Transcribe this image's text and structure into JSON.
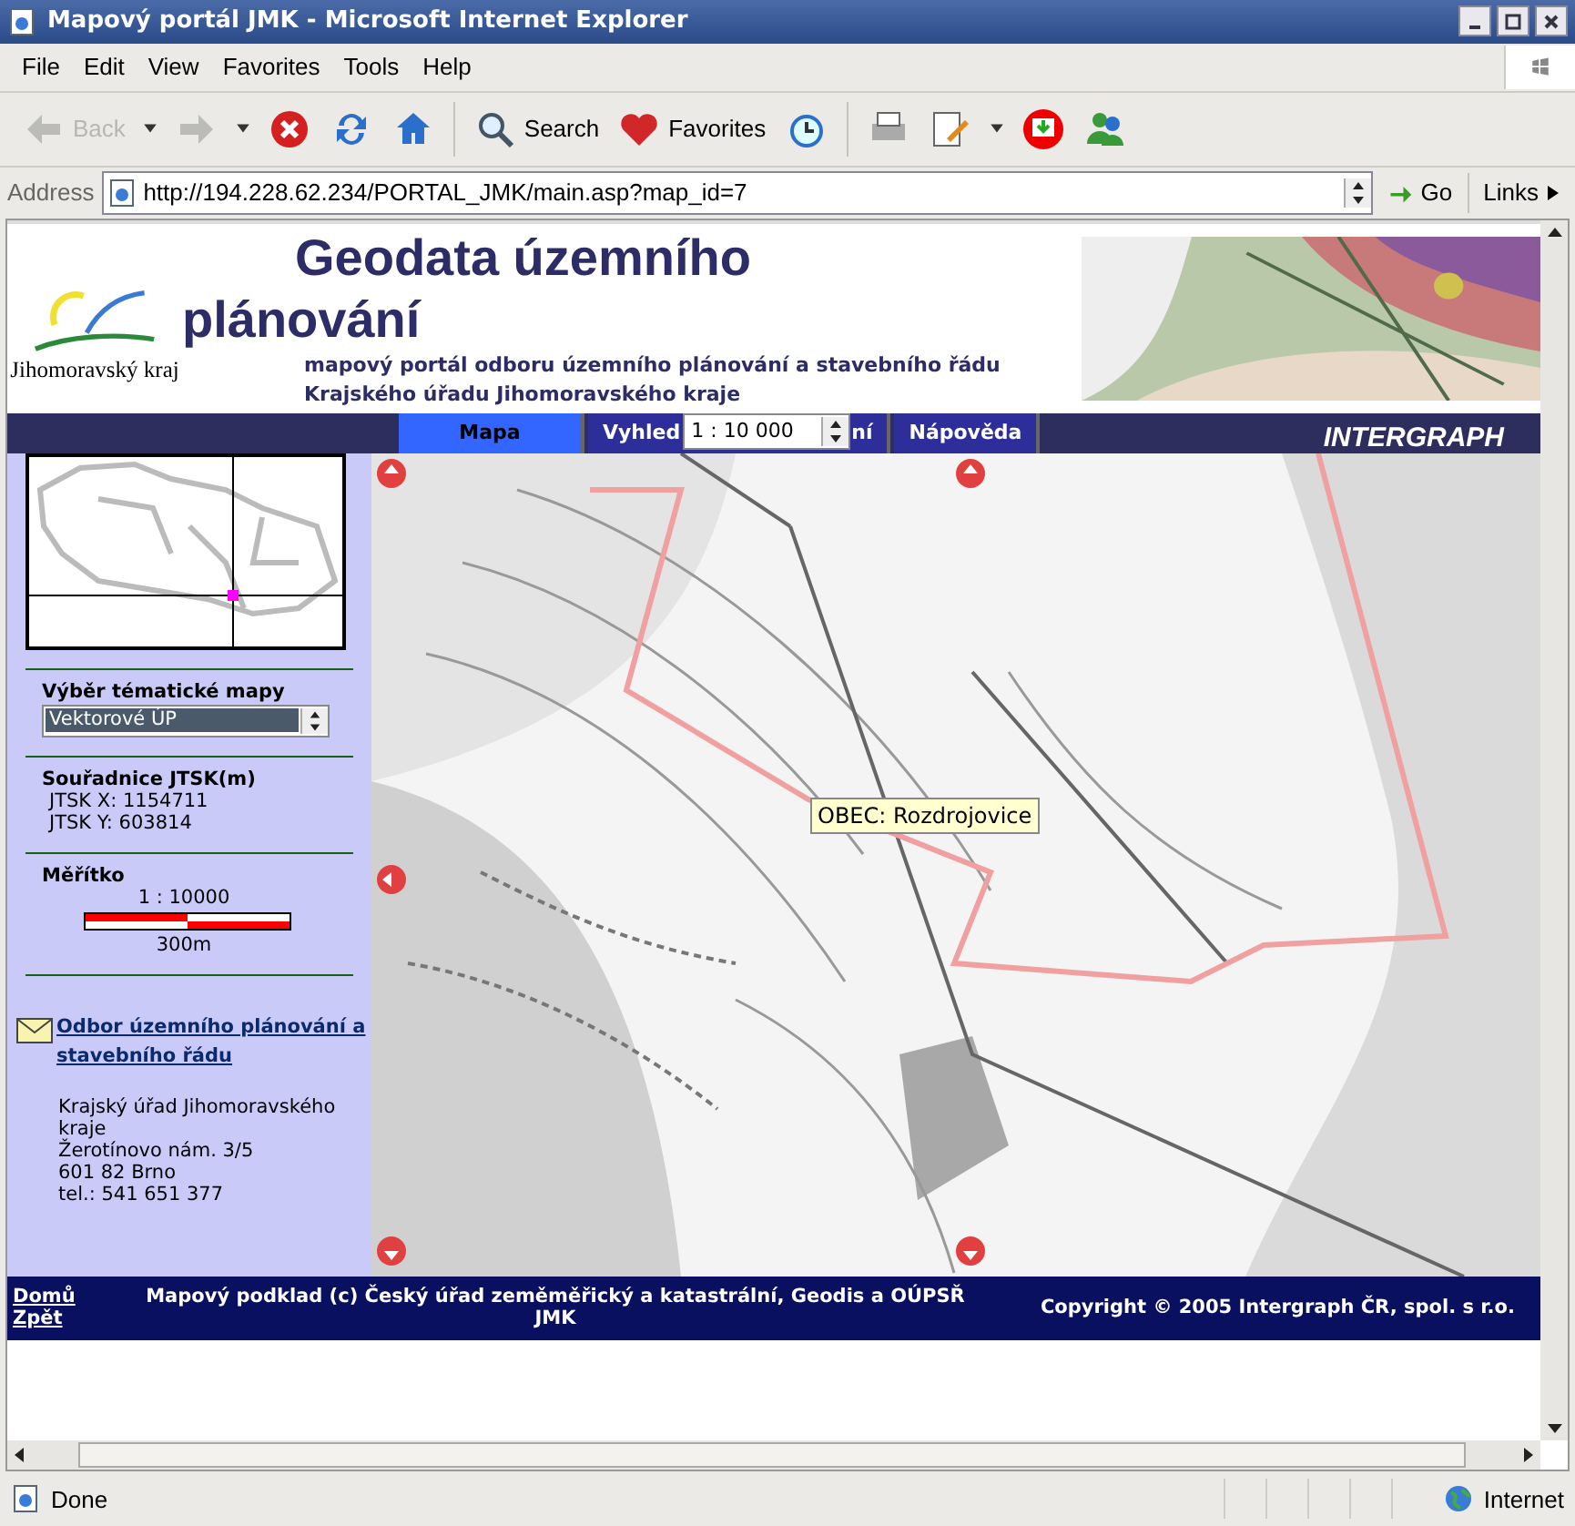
{
  "window": {
    "title": "Mapový portál JMK - Microsoft Internet Explorer"
  },
  "menu": [
    "File",
    "Edit",
    "View",
    "Favorites",
    "Tools",
    "Help"
  ],
  "toolbar": [
    {
      "kind": "back",
      "label": "Back",
      "disabled": true
    },
    {
      "kind": "dropdown"
    },
    {
      "kind": "forward",
      "disabled": true
    },
    {
      "kind": "dropdown"
    },
    {
      "kind": "stop"
    },
    {
      "kind": "refresh"
    },
    {
      "kind": "home"
    },
    {
      "kind": "separator"
    },
    {
      "kind": "search",
      "label": "Search"
    },
    {
      "kind": "favorites",
      "label": "Favorites"
    },
    {
      "kind": "history"
    },
    {
      "kind": "separator"
    },
    {
      "kind": "print"
    },
    {
      "kind": "edit"
    },
    {
      "kind": "dropdown"
    },
    {
      "kind": "download"
    },
    {
      "kind": "messenger"
    }
  ],
  "address": {
    "label": "Address",
    "value": "http://194.228.62.234/PORTAL_JMK/main.asp?map_id=7",
    "go": "Go",
    "links": "Links"
  },
  "header": {
    "logo_text": "Jihomoravský kraj",
    "title_lines": [
      "Geodata územního",
      "plánování"
    ],
    "subtitle_lines": [
      "mapový portál odboru územního plánování a stavebního řádu",
      "Krajského úřadu Jihomoravského kraje"
    ]
  },
  "nav": {
    "tabs": [
      {
        "label": "Mapa",
        "selected": true
      },
      {
        "label": "Vyhled",
        "label_end": "ní",
        "selected": false
      },
      {
        "label": "Nápověda",
        "selected": false
      }
    ],
    "scale_select": "1 : 10 000",
    "brand": "INTERGRAPH"
  },
  "sidebar": {
    "theme": {
      "label": "Výběr tématické mapy",
      "value": "Vektorové ÚP"
    },
    "coords": {
      "title": "Souřadnice JTSK(m)",
      "x": "JTSK X: 1154711",
      "y": "JTSK Y: 603814"
    },
    "scale": {
      "title": "Měřítko",
      "ratio": "1 : 10000",
      "bar_label": "300m"
    },
    "contact": {
      "link": "Odbor územního plánování a stavebního řádu",
      "lines": [
        "Krajský úřad Jihomoravského kraje",
        "Žerotínovo nám. 3/5",
        "601 82 Brno",
        "tel.: 541 651 377"
      ]
    }
  },
  "map": {
    "tooltip": "OBEC: Rozdrojovice"
  },
  "footer": {
    "links": [
      "Domů",
      "Zpět"
    ],
    "credit": "Mapový podklad (c) Český úřad zeměměřický a katastrální, Geodis a OÚPSŘ JMK",
    "copyright": "Copyright © 2005 Intergraph ČR, spol. s r.o."
  },
  "status": {
    "text": "Done",
    "zone": "Internet"
  }
}
